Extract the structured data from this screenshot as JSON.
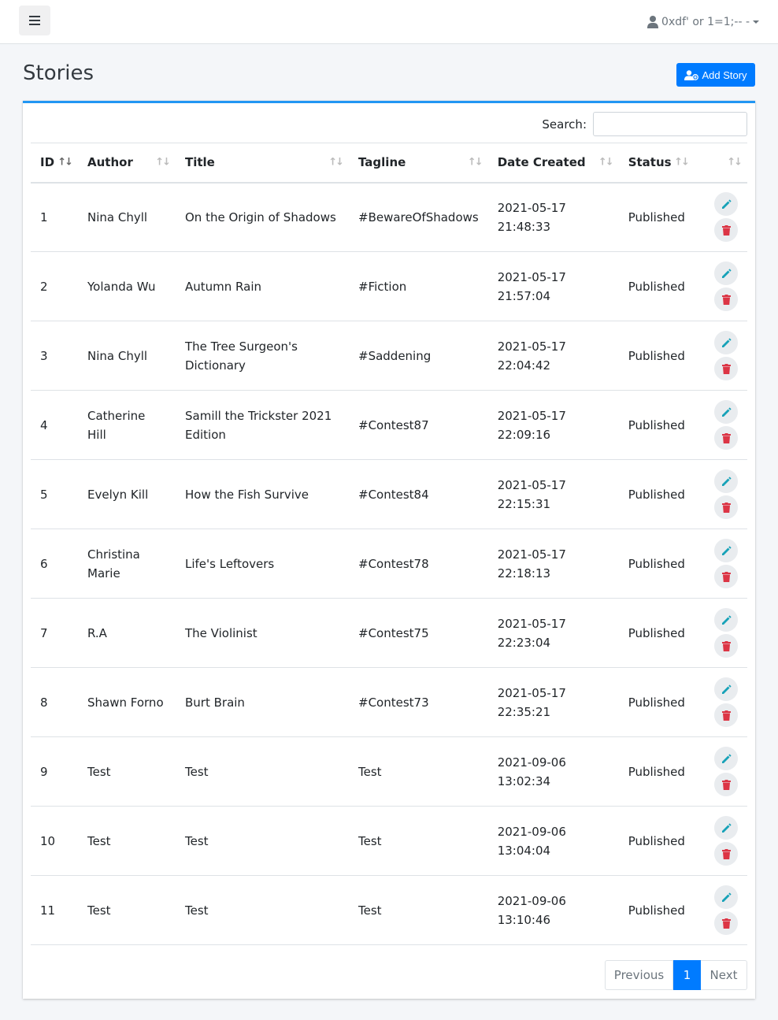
{
  "header": {
    "user_label": "0xdf' or 1=1;-- -"
  },
  "page": {
    "title": "Stories",
    "add_button": "Add Story",
    "search_label": "Search:",
    "search_value": ""
  },
  "table": {
    "columns": [
      "ID",
      "Author",
      "Title",
      "Tagline",
      "Date Created",
      "Status",
      ""
    ],
    "rows": [
      {
        "id": "1",
        "author": "Nina Chyll",
        "title": "On the Origin of Shadows",
        "tagline": "#BewareOfShadows",
        "date": "2021-05-17",
        "time": "21:48:33",
        "status": "Published"
      },
      {
        "id": "2",
        "author": "Yolanda Wu",
        "title": "Autumn Rain",
        "tagline": "#Fiction",
        "date": "2021-05-17",
        "time": "21:57:04",
        "status": "Published"
      },
      {
        "id": "3",
        "author": "Nina Chyll",
        "title": "The Tree Surgeon's Dictionary",
        "tagline": "#Saddening",
        "date": "2021-05-17",
        "time": "22:04:42",
        "status": "Published"
      },
      {
        "id": "4",
        "author": "Catherine Hill",
        "title": "Samill the Trickster 2021 Edition",
        "tagline": "#Contest87",
        "date": "2021-05-17",
        "time": "22:09:16",
        "status": "Published"
      },
      {
        "id": "5",
        "author": "Evelyn Kill",
        "title": "How the Fish Survive",
        "tagline": "#Contest84",
        "date": "2021-05-17",
        "time": "22:15:31",
        "status": "Published"
      },
      {
        "id": "6",
        "author": "Christina Marie",
        "title": "Life's Leftovers",
        "tagline": "#Contest78",
        "date": "2021-05-17",
        "time": "22:18:13",
        "status": "Published"
      },
      {
        "id": "7",
        "author": "R.A",
        "title": "The Violinist",
        "tagline": "#Contest75",
        "date": "2021-05-17",
        "time": "22:23:04",
        "status": "Published"
      },
      {
        "id": "8",
        "author": "Shawn Forno",
        "title": "Burt Brain",
        "tagline": "#Contest73",
        "date": "2021-05-17",
        "time": "22:35:21",
        "status": "Published"
      },
      {
        "id": "9",
        "author": "Test",
        "title": "Test",
        "tagline": "Test",
        "date": "2021-09-06",
        "time": "13:02:34",
        "status": "Published"
      },
      {
        "id": "10",
        "author": "Test",
        "title": "Test",
        "tagline": "Test",
        "date": "2021-09-06",
        "time": "13:04:04",
        "status": "Published"
      },
      {
        "id": "11",
        "author": "Test",
        "title": "Test",
        "tagline": "Test",
        "date": "2021-09-06",
        "time": "13:10:46",
        "status": "Published"
      }
    ]
  },
  "pagination": {
    "previous": "Previous",
    "current": "1",
    "next": "Next"
  },
  "colors": {
    "primary": "#007bff",
    "edit_icon": "#17a2b8",
    "delete_icon": "#dc3545",
    "card_accent": "#2196f3"
  },
  "icons": {
    "menu": "hamburger-icon",
    "user": "user-icon",
    "add": "user-plus-icon",
    "edit": "pencil-icon",
    "delete": "trash-icon"
  }
}
